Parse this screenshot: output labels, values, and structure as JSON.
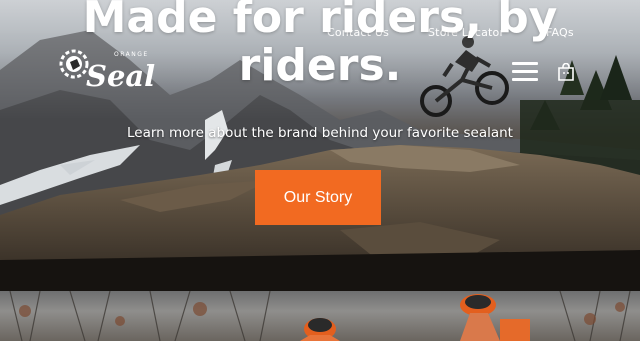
{
  "brand": {
    "wordmark": "Seal",
    "overline": "ORANGE"
  },
  "nav": {
    "contact": "Contact Us",
    "store_locator": "Store Locator",
    "faqs": "FAQs"
  },
  "hero": {
    "headline": "Made for riders, by riders.",
    "subheadline": "Learn more about the brand behind your favorite sealant",
    "cta_label": "Our Story"
  },
  "colors": {
    "accent": "#f26a21",
    "text": "#ffffff"
  },
  "icons": {
    "menu": "hamburger-menu-icon",
    "cart": "shopping-bag-icon"
  }
}
